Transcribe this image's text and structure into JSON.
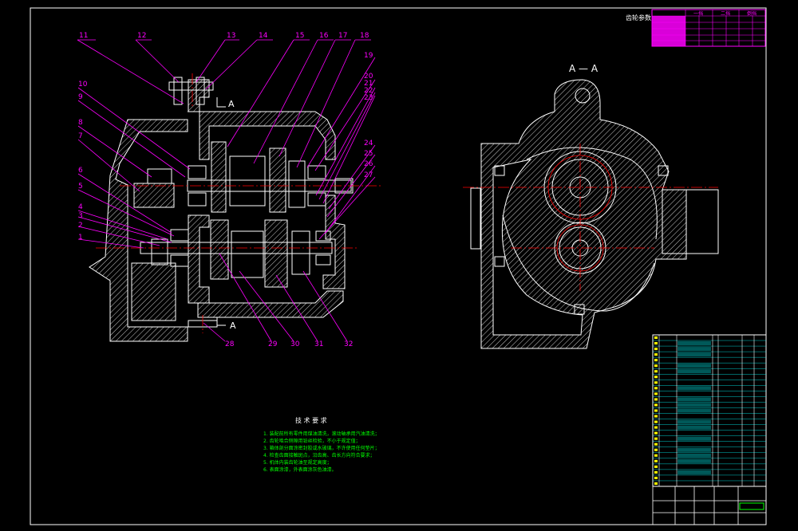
{
  "colors": {
    "background": "#000000",
    "outline": "#ffffff",
    "leader": "#ff00ff",
    "centerline": "#ff0000",
    "table_text": "#ffff00",
    "notes": "#00ff00",
    "bom_highlight": "#00ffff",
    "bom_line": "#00ffff"
  },
  "drawing": {
    "section_title": "A — A",
    "section_marker_top": "A",
    "section_marker_bottom": "A",
    "part_numbers_top": [
      "11",
      "12",
      "13",
      "14",
      "15",
      "16",
      "17",
      "18"
    ],
    "part_numbers_left": [
      "10",
      "9",
      "8",
      "7",
      "6",
      "5",
      "4",
      "3",
      "2",
      "1"
    ],
    "part_numbers_right": [
      "19",
      "20",
      "21",
      "22",
      "23",
      "24",
      "25",
      "26",
      "27"
    ],
    "part_numbers_bottom": [
      "28",
      "29",
      "30",
      "31",
      "32"
    ]
  },
  "gear_table": {
    "title": "齿轮参数",
    "headers": [
      "一挡",
      "二挡",
      "倒挡"
    ]
  },
  "tech_req": {
    "title": "技 术 要 求",
    "lines": [
      "1. 装配前所有零件用煤油清洗，滚动轴承用汽油清洗；",
      "2. 齿轮啮合侧隙用铅丝检验，不小于规定值；",
      "3. 箱体剖分面涂密封胶或水玻璃，不许使用任何垫片；",
      "4. 检查齿面接触斑点，沿齿高、齿长方向符合要求；",
      "5. 机体内装齿轮油至规定高度；",
      "6. 表面涂漆，外表面涂灰色油漆。"
    ]
  }
}
